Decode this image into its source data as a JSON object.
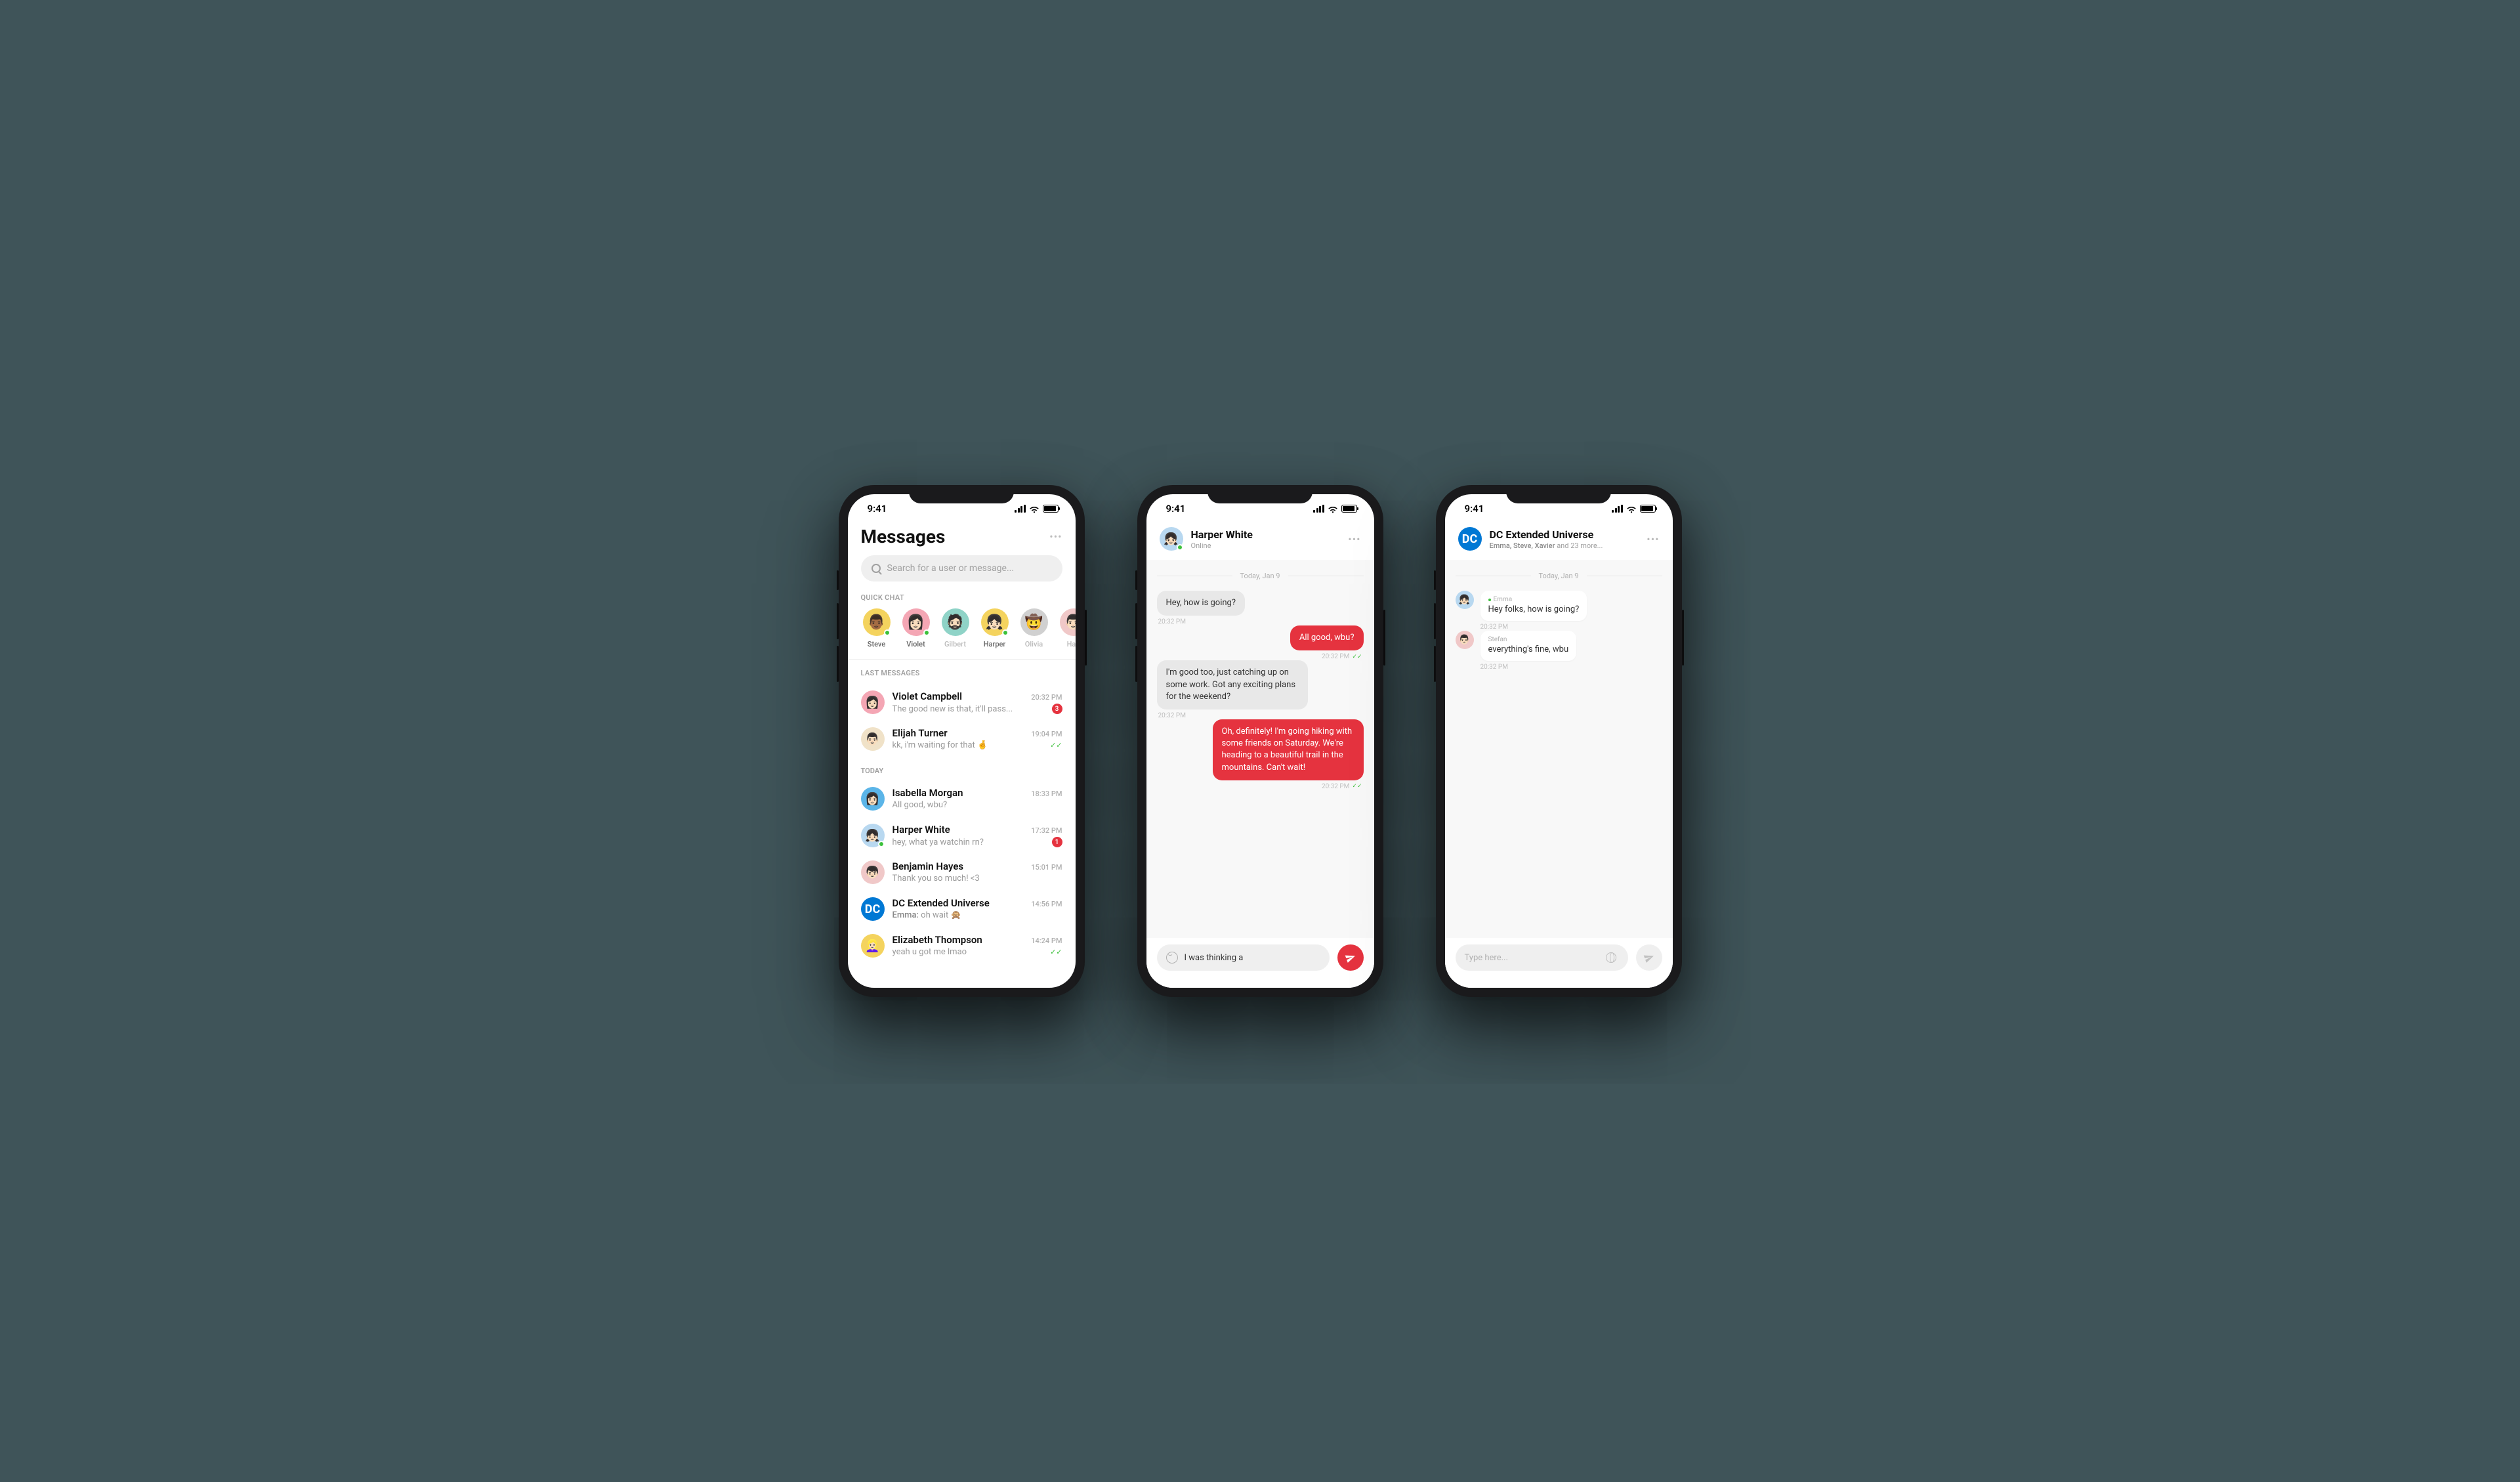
{
  "status": {
    "time": "9:41"
  },
  "phone1": {
    "title": "Messages",
    "search_placeholder": "Search for a user or message...",
    "quick_chat_label": "QUICK CHAT",
    "last_messages_label": "LAST MESSAGES",
    "today_label": "TODAY",
    "quick": [
      {
        "name": "Steve",
        "emoji": "👨🏾",
        "bg": "av-yellow",
        "online": true,
        "dim": false
      },
      {
        "name": "Violet",
        "emoji": "👩🏻",
        "bg": "av-pink",
        "online": true,
        "dim": false
      },
      {
        "name": "Gilbert",
        "emoji": "🧔🏻",
        "bg": "av-teal",
        "online": false,
        "dim": true
      },
      {
        "name": "Harper",
        "emoji": "👧🏻",
        "bg": "av-yellow",
        "online": true,
        "dim": false
      },
      {
        "name": "Olivia",
        "emoji": "🤠",
        "bg": "av-grey",
        "online": false,
        "dim": true
      },
      {
        "name": "Han",
        "emoji": "👨🏻",
        "bg": "av-ltpink",
        "online": true,
        "dim": true
      }
    ],
    "last": [
      {
        "name": "Violet Campbell",
        "emoji": "👩🏻",
        "bg": "av-pink",
        "preview": "The good new is that, it'll pass...",
        "time": "20:32 PM",
        "badge": "3"
      },
      {
        "name": "Elijah Turner",
        "emoji": "👨🏻",
        "bg": "av-cream",
        "preview": "kk, i'm waiting for that 🤞",
        "time": "19:04 PM",
        "checks": true
      }
    ],
    "today": [
      {
        "name": "Isabella Morgan",
        "emoji": "👩🏻",
        "bg": "av-blue",
        "preview": "All good, wbu?",
        "time": "18:33 PM"
      },
      {
        "name": "Harper White",
        "emoji": "👧🏻",
        "bg": "av-ltblue",
        "preview": "hey, what ya watchin rn?",
        "time": "17:32 PM",
        "badge": "1",
        "online": true
      },
      {
        "name": "Benjamin Hayes",
        "emoji": "👦🏻",
        "bg": "av-ltpink",
        "preview": "Thank you so much! <3",
        "time": "15:01 PM"
      },
      {
        "name": "DC Extended Universe",
        "text": "DC",
        "bg": "av-dcblue",
        "sender": "Emma:",
        "preview": "oh wait 🙊",
        "time": "14:56 PM"
      },
      {
        "name": "Elizabeth Thompson",
        "emoji": "👱🏻‍♀️",
        "bg": "av-yellow",
        "preview": "yeah u got me lmao",
        "time": "14:24 PM",
        "checks": true
      }
    ]
  },
  "phone2": {
    "title": "Harper White",
    "subtitle": "Online",
    "avatar_emoji": "👧🏻",
    "avatar_bg": "av-ltblue",
    "date": "Today, Jan 9",
    "messages": [
      {
        "side": "left",
        "text": "Hey, how is going?",
        "time": "20:32 PM"
      },
      {
        "side": "right",
        "text": "All good, wbu?",
        "time": "20:32 PM",
        "checks": true
      },
      {
        "side": "left",
        "text": "I'm good too, just catching up on some work. Got any exciting plans for the weekend?",
        "time": "20:32 PM"
      },
      {
        "side": "right",
        "text": "Oh, definitely! I'm going hiking with some friends on Saturday. We're heading to a beautiful trail in the mountains. Can't wait!",
        "time": "20:32 PM",
        "checks": true
      }
    ],
    "input_value": "I was thinking a"
  },
  "phone3": {
    "title": "DC Extended Universe",
    "subtitle_prefix": "Emma, Steve, Xavier",
    "subtitle_suffix": " and 23 more...",
    "avatar_text": "DC",
    "date": "Today, Jan 9",
    "messages": [
      {
        "sender": "Emma",
        "emoji": "👧🏻",
        "bg": "av-ltblue",
        "text": "Hey folks, how is going?",
        "time": "20:32 PM",
        "online": true
      },
      {
        "sender": "Stefan",
        "emoji": "👨🏻",
        "bg": "av-ltpink",
        "text": "everything's fine, wbu",
        "time": "20:32 PM"
      }
    ],
    "input_placeholder": "Type here..."
  }
}
